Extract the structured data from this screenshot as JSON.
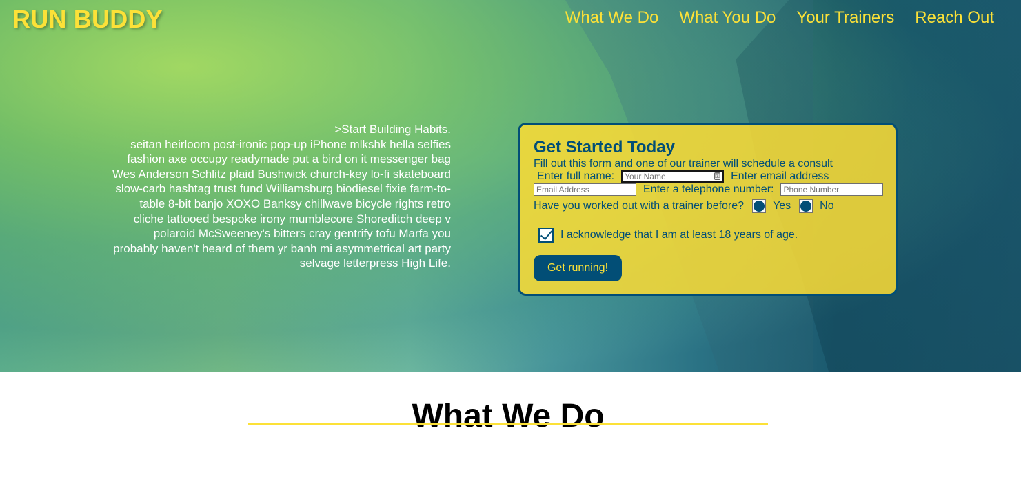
{
  "brand": {
    "name": "RUN BUDDY"
  },
  "nav": {
    "items": [
      {
        "label": "What We Do"
      },
      {
        "label": "What You Do"
      },
      {
        "label": "Your Trainers"
      },
      {
        "label": "Reach Out"
      }
    ]
  },
  "intro": {
    "heading": ">Start Building Habits.",
    "body": "seitan heirloom post-ironic pop-up iPhone mlkshk hella selfies fashion axe occupy readymade put a bird on it messenger bag Wes Anderson Schlitz plaid Bushwick church-key lo-fi skateboard slow-carb hashtag trust fund Williamsburg biodiesel fixie farm-to-table 8-bit banjo XOXO Banksy chillwave bicycle rights retro cliche tattooed bespoke irony mumblecore Shoreditch deep v polaroid McSweeney's bitters cray gentrify tofu Marfa you probably haven't heard of them yr banh mi asymmetrical art party selvage letterpress High Life."
  },
  "form": {
    "title": "Get Started Today",
    "subtitle": "Fill out this form and one of our trainer will schedule a consult",
    "full_name_label": "Enter full name:",
    "full_name_placeholder": "Your Name",
    "email_label": "Enter email address",
    "email_placeholder": "Email Address",
    "phone_label": "Enter a telephone number:",
    "phone_placeholder": "Phone Number",
    "trainer_question": "Have you worked out with a trainer before?",
    "radio_yes": "Yes",
    "radio_no": "No",
    "age_ack": "I acknowledge that I am at least 18 years of age.",
    "submit_label": "Get running!"
  },
  "section": {
    "title": "What We Do"
  },
  "colors": {
    "accent_yellow": "#fce138",
    "primary_blue": "#024e76",
    "white": "#ffffff",
    "black": "#000000"
  },
  "icons": {
    "password_manager": "key-icon",
    "checkbox_checked": "checkmark-icon"
  }
}
